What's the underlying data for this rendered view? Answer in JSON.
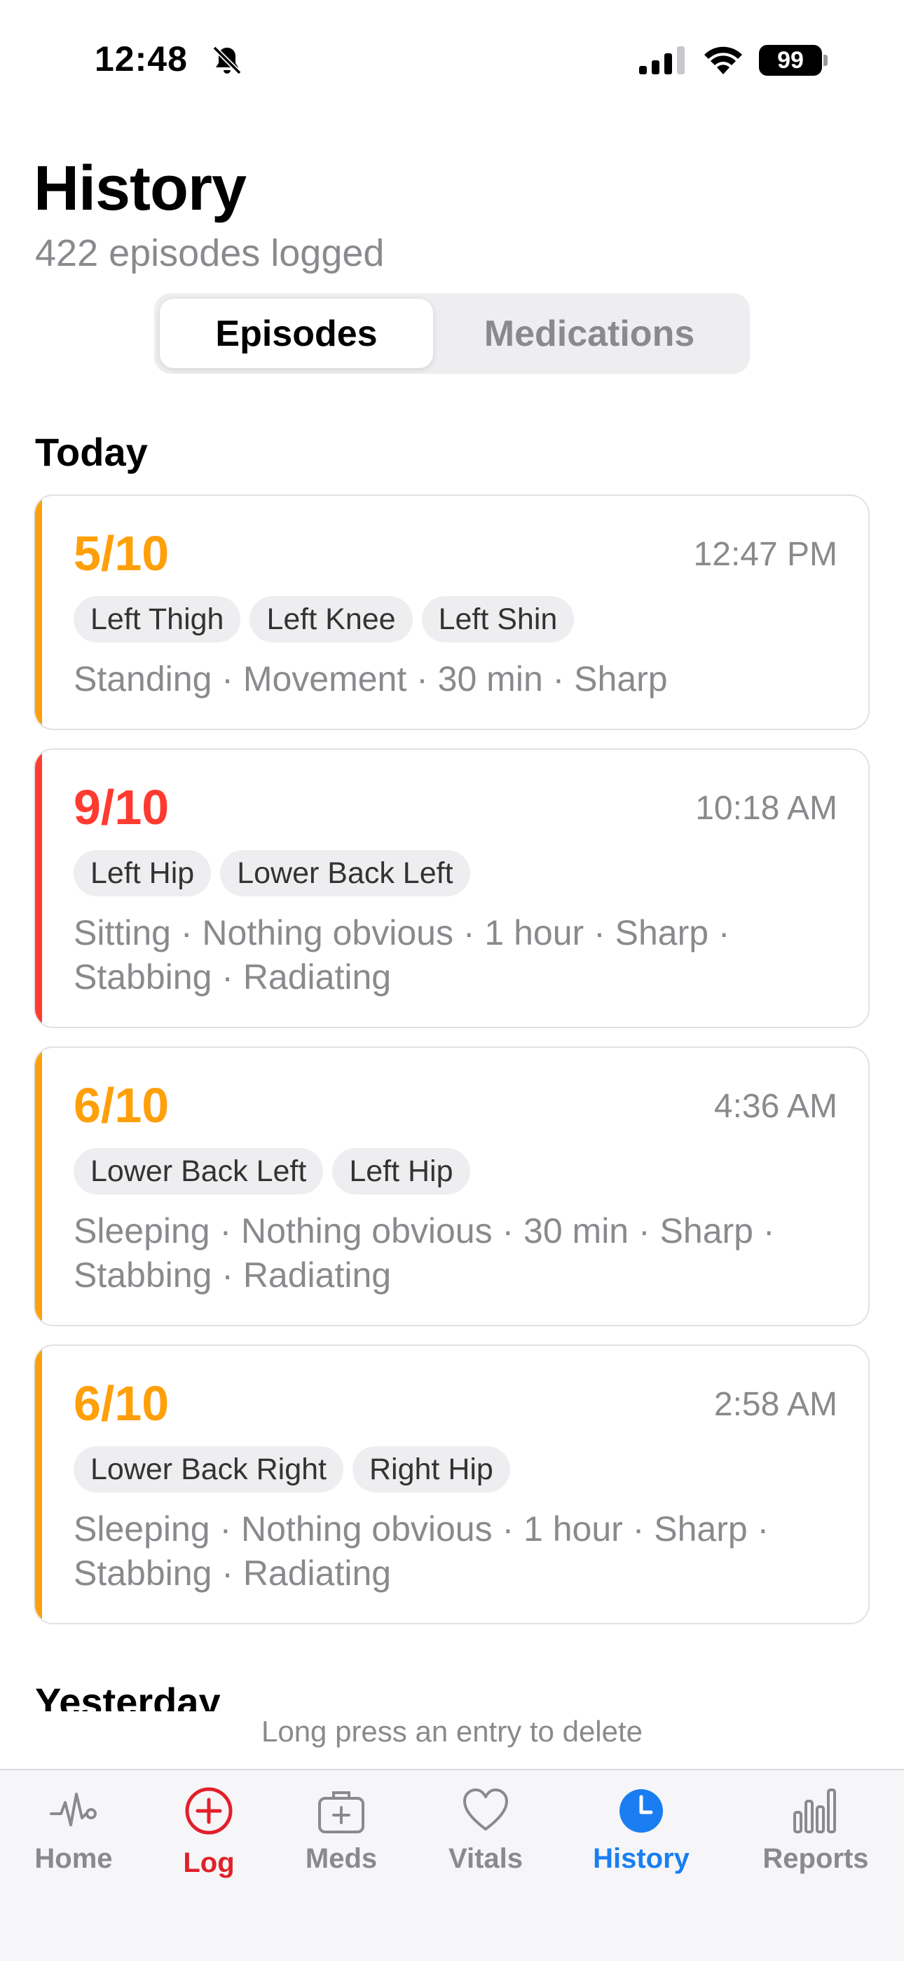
{
  "status_bar": {
    "time": "12:48",
    "battery": "99"
  },
  "header": {
    "title": "History",
    "subtitle": "422 episodes logged"
  },
  "segmented": {
    "active": "Episodes",
    "inactive": "Medications"
  },
  "sections": {
    "today": "Today",
    "yesterday": "Yesterday"
  },
  "episodes": [
    {
      "score": "5/10",
      "time": "12:47 PM",
      "severity_color": "#ff9f0a",
      "tags": [
        "Left Thigh",
        "Left Knee",
        "Left Shin"
      ],
      "details": "Standing · Movement · 30 min · Sharp"
    },
    {
      "score": "9/10",
      "time": "10:18 AM",
      "severity_color": "#ff3b30",
      "tags": [
        "Left Hip",
        "Lower Back Left"
      ],
      "details": "Sitting · Nothing obvious · 1 hour · Sharp · Stabbing · Radiating"
    },
    {
      "score": "6/10",
      "time": "4:36 AM",
      "severity_color": "#ff9f0a",
      "tags": [
        "Lower Back Left",
        "Left Hip"
      ],
      "details": "Sleeping · Nothing obvious · 30 min · Sharp · Stabbing · Radiating"
    },
    {
      "score": "6/10",
      "time": "2:58 AM",
      "severity_color": "#ff9f0a",
      "tags": [
        "Lower Back Right",
        "Right Hip"
      ],
      "details": "Sleeping · Nothing obvious · 1 hour · Sharp · Stabbing · Radiating"
    }
  ],
  "hint": "Long press an entry to delete",
  "tab_bar": {
    "active_color": "#1a7ef2",
    "log_color": "#e1202a",
    "tabs": [
      {
        "label": "Home",
        "icon": "pulse-icon"
      },
      {
        "label": "Log",
        "icon": "plus-circle-icon"
      },
      {
        "label": "Meds",
        "icon": "medkit-icon"
      },
      {
        "label": "Vitals",
        "icon": "heart-icon"
      },
      {
        "label": "History",
        "icon": "clock-icon"
      },
      {
        "label": "Reports",
        "icon": "bar-chart-icon"
      }
    ]
  }
}
